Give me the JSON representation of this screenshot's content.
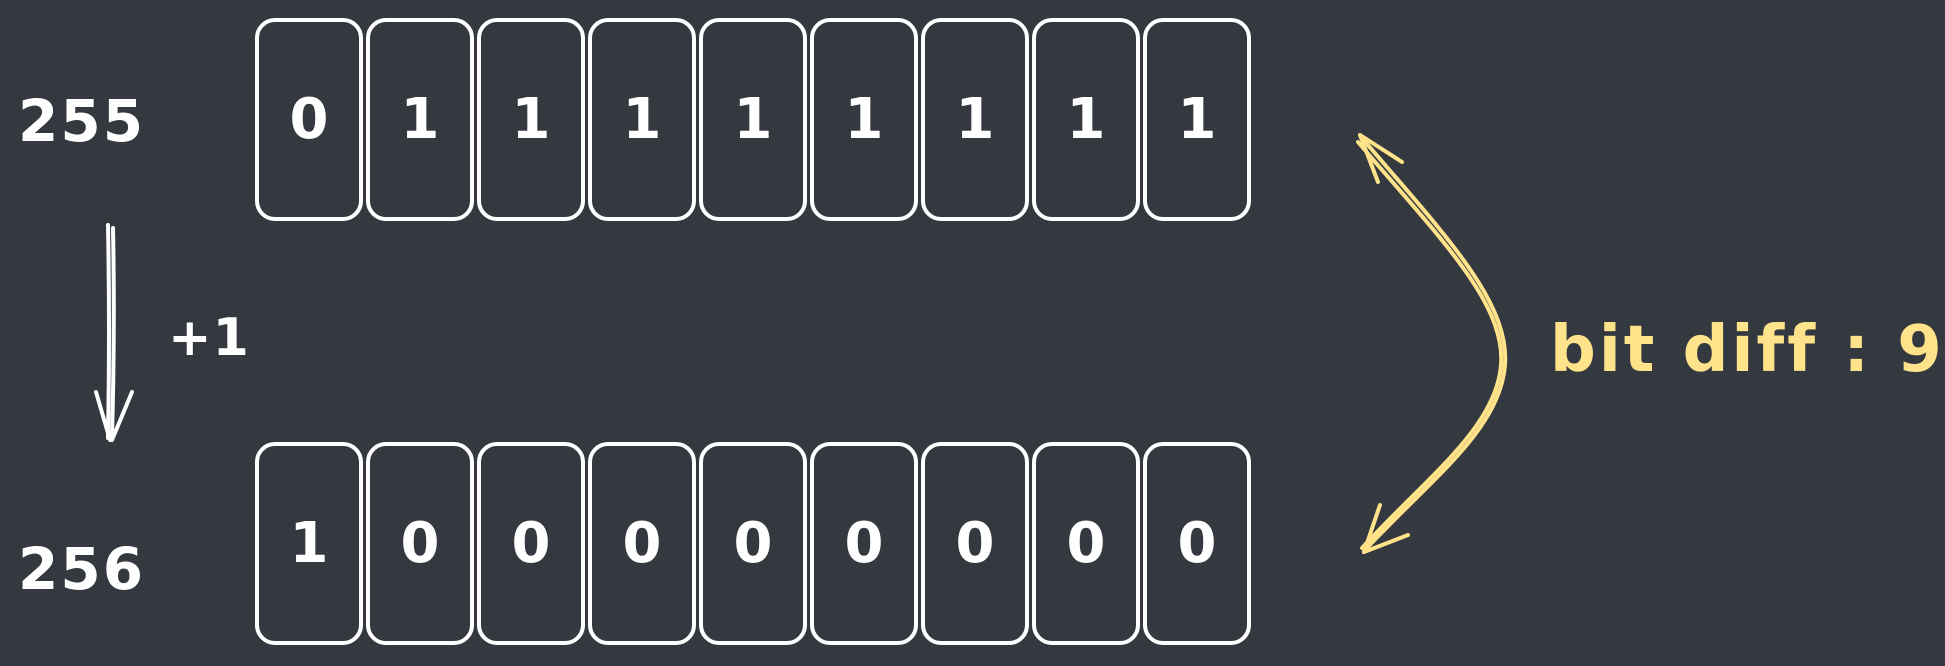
{
  "numbers": {
    "top": "255",
    "bottom": "256"
  },
  "operation": {
    "label": "+1"
  },
  "bits": {
    "top": [
      "0",
      "1",
      "1",
      "1",
      "1",
      "1",
      "1",
      "1",
      "1"
    ],
    "bottom": [
      "1",
      "0",
      "0",
      "0",
      "0",
      "0",
      "0",
      "0",
      "0"
    ]
  },
  "annotation": {
    "text": "bit diff : 9"
  },
  "colors": {
    "background": "#343940",
    "stroke": "#ffffff",
    "accent": "#ffe38a"
  }
}
